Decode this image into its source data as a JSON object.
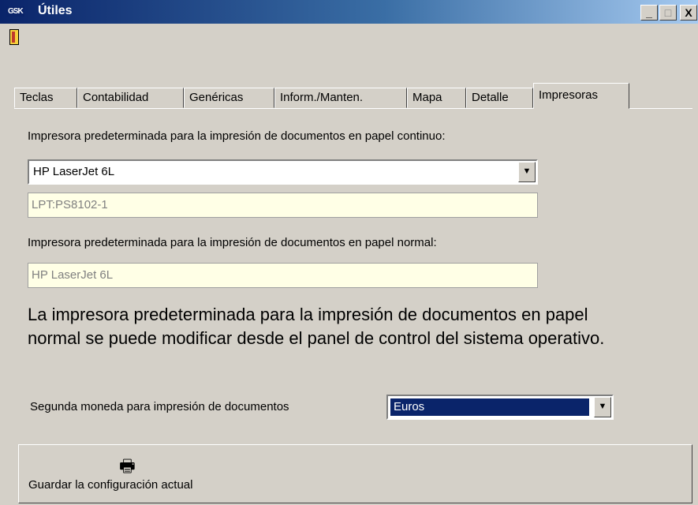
{
  "window": {
    "logo": "GSK",
    "title": "Útiles",
    "controls": {
      "minimize": "_",
      "maximize": "□",
      "close": "X"
    }
  },
  "toolbar": {
    "exit_icon": "door-exit-icon"
  },
  "tabs": [
    {
      "label": "Teclas",
      "active": false
    },
    {
      "label": "Contabilidad",
      "active": false
    },
    {
      "label": "Genéricas",
      "active": false
    },
    {
      "label": "Inform./Manten.",
      "active": false
    },
    {
      "label": "Mapa",
      "active": false
    },
    {
      "label": "Detalle",
      "active": false
    },
    {
      "label": "Impresoras",
      "active": true
    }
  ],
  "continuous": {
    "label": "Impresora predeterminada para la impresión de documentos en papel continuo:",
    "printer": "HP LaserJet 6L",
    "port": "LPT:PS8102-1"
  },
  "normal": {
    "label": "Impresora predeterminada para la impresión de documentos en papel normal:",
    "printer": "HP LaserJet 6L"
  },
  "info_text": "La impresora predeterminada para la impresión de documentos en papel normal se puede modificar desde el panel de control del sistema operativo.",
  "currency": {
    "label": "Segunda moneda para impresión de documentos",
    "value": "Euros"
  },
  "save": {
    "icon": "printer-icon",
    "label": "Guardar la configuración actual"
  },
  "colors": {
    "titlebar_start": "#0a246a",
    "face": "#d4d0c8",
    "readonly_bg": "#ffffe6",
    "selection": "#0a246a"
  }
}
